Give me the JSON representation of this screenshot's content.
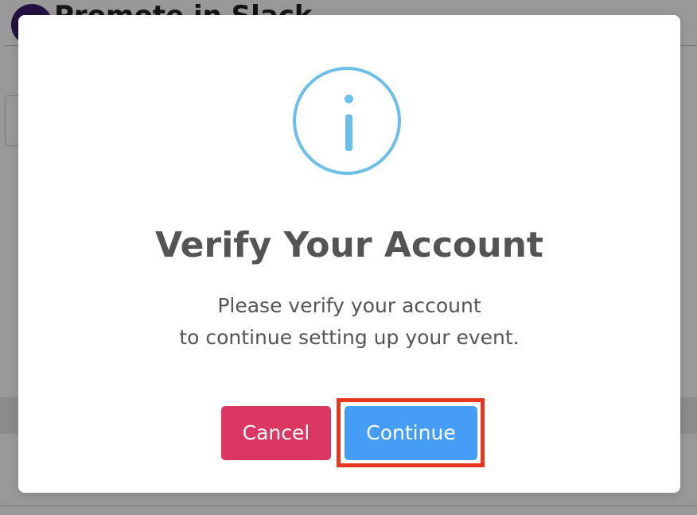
{
  "background": {
    "brand_name": "Promote in Slack"
  },
  "modal": {
    "icon": "info-icon",
    "title": "Verify Your Account",
    "message_line1": "Please verify your account",
    "message_line2": "to continue setting up your event.",
    "cancel_label": "Cancel",
    "continue_label": "Continue"
  },
  "colors": {
    "icon": "#6cbfe9",
    "cancel": "#dc3663",
    "continue": "#459df7",
    "highlight": "#e8371f",
    "text": "#545454"
  }
}
